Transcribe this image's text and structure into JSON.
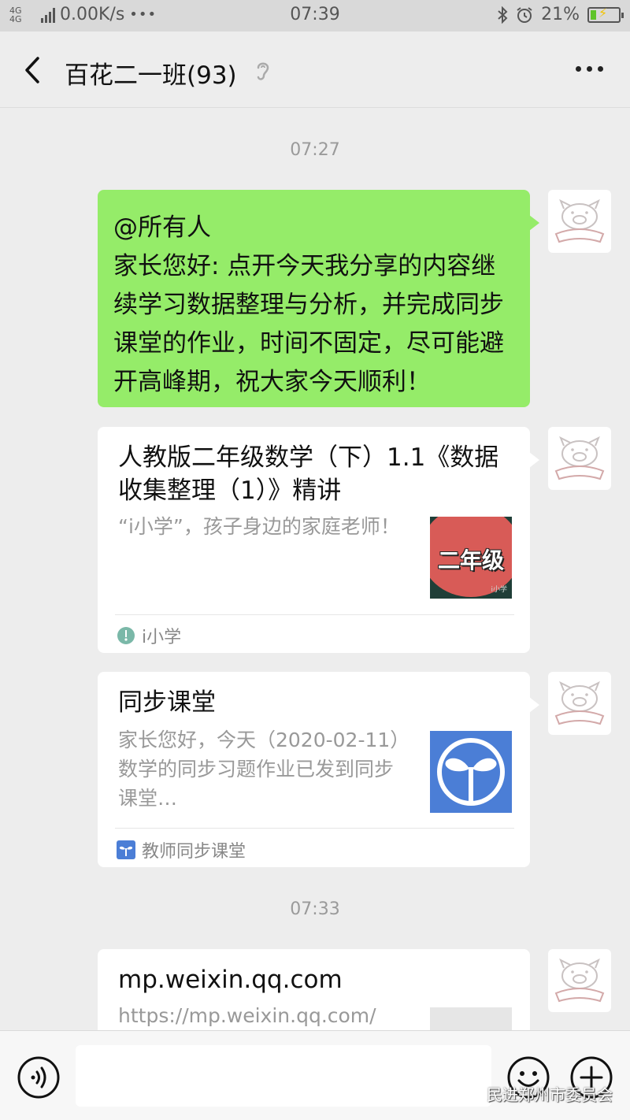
{
  "status_bar": {
    "network": "4G 4G",
    "speed": "0.00K/s",
    "dots": "•••",
    "time": "07:39",
    "battery": "21%",
    "battery_level": 0.21
  },
  "nav": {
    "title": "百花二一班(93)"
  },
  "messages": {
    "timestamp_1": "07:27",
    "text": {
      "line1": "@所有人",
      "line2": "家长您好: 点开今天我分享的内容继续学习数据整理与分析，并完成同步课堂的作业，时间不固定，尽可能避开高峰期，祝大家今天顺利！"
    },
    "card_1": {
      "title": "人教版二年级数学（下）1.1《数据收集整理（1）》精讲",
      "description": "“i小学”，孩子身边的家庭老师！",
      "thumb_label": "二年级",
      "thumb_watermark": "i小学",
      "source": "i小学"
    },
    "card_2": {
      "title": "同步课堂",
      "description": "家长您好，今天（2020-02-11）数学的同步习题作业已发到同步课堂…",
      "source": "教师同步课堂"
    },
    "timestamp_2": "07:33",
    "card_3": {
      "title": "mp.weixin.qq.com",
      "description": "https://mp.weixin.qq.com/"
    }
  },
  "input_bar": {
    "watermark": "民进郑州市委员会"
  },
  "colors": {
    "self_bubble": "#95ec69",
    "background": "#ededed",
    "thumb_blue": "#4b7ed6",
    "thumb_red": "#d85b57"
  },
  "icons": [
    "back-icon",
    "ear-icon",
    "more-icon",
    "pig-avatar",
    "voice-icon",
    "emoji-icon",
    "plus-icon",
    "sprout-icon"
  ]
}
